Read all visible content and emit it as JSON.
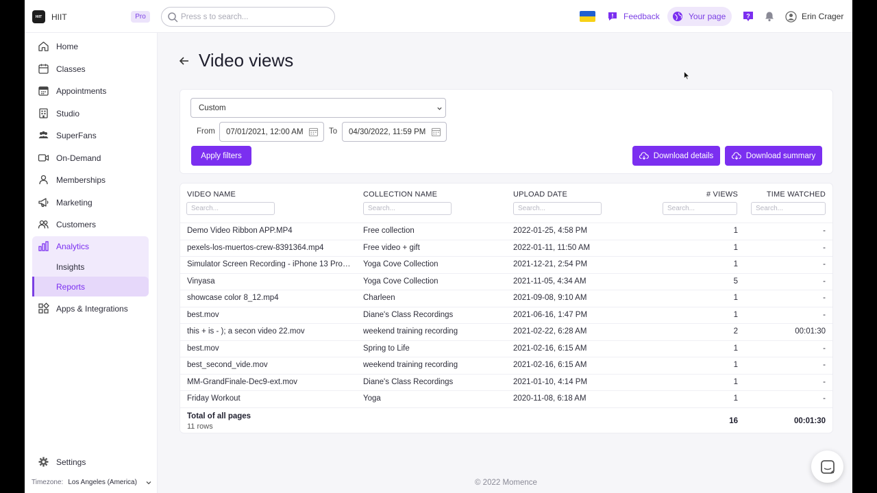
{
  "topbar": {
    "app_name": "HIIT",
    "logo_text": "HIIT",
    "badge": "Pro",
    "search_placeholder": "Press s to search...",
    "feedback": "Feedback",
    "your_page": "Your page",
    "user_name": "Erin Crager"
  },
  "sidebar": {
    "items": [
      {
        "label": "Home",
        "icon": "home-icon"
      },
      {
        "label": "Classes",
        "icon": "calendar-icon"
      },
      {
        "label": "Appointments",
        "icon": "appointments-icon"
      },
      {
        "label": "Studio",
        "icon": "studio-icon"
      },
      {
        "label": "SuperFans",
        "icon": "superfans-icon"
      },
      {
        "label": "On-Demand",
        "icon": "video-icon"
      },
      {
        "label": "Memberships",
        "icon": "memberships-icon"
      },
      {
        "label": "Marketing",
        "icon": "megaphone-icon"
      },
      {
        "label": "Customers",
        "icon": "customers-icon"
      },
      {
        "label": "Analytics",
        "icon": "analytics-icon"
      }
    ],
    "sub_items": [
      "Insights",
      "Reports"
    ],
    "apps": "Apps & Integrations",
    "settings": "Settings",
    "timezone_label": "Timezone:",
    "timezone_value": "Los Angeles (America)"
  },
  "page": {
    "title": "Video views"
  },
  "filters": {
    "range_select": "Custom",
    "from_label": "From",
    "from_value": "07/01/2021, 12:00 AM",
    "to_label": "To",
    "to_value": "04/30/2022, 11:59 PM",
    "apply": "Apply filters",
    "download_details": "Download details",
    "download_summary": "Download summary"
  },
  "table": {
    "headers": [
      "VIDEO NAME",
      "COLLECTION NAME",
      "UPLOAD DATE",
      "# VIEWS",
      "TIME WATCHED"
    ],
    "search_placeholder": "Search...",
    "rows": [
      [
        "Demo Video Ribbon APP.MP4",
        "Free collection",
        "2022-01-25, 4:58 PM",
        "1",
        "-"
      ],
      [
        "pexels-los-muertos-crew-8391364.mp4",
        "Free video + gift",
        "2022-01-11, 11:50 AM",
        "1",
        "-"
      ],
      [
        "Simulator Screen Recording - iPhone 13 Pro -...",
        "Yoga Cove Collection",
        "2021-12-21, 2:54 PM",
        "1",
        "-"
      ],
      [
        "Vinyasa",
        "Yoga Cove Collection",
        "2021-11-05, 4:34 AM",
        "5",
        "-"
      ],
      [
        "showcase color 8_12.mp4",
        "Charleen",
        "2021-09-08, 9:10 AM",
        "1",
        "-"
      ],
      [
        "best.mov",
        "Diane's Class Recordings",
        "2021-06-16, 1:47 PM",
        "1",
        "-"
      ],
      [
        "this + is - ); a secon video 22.mov",
        "weekend training recording",
        "2021-02-22, 6:28 AM",
        "2",
        "00:01:30"
      ],
      [
        "best.mov",
        "Spring to Life",
        "2021-02-16, 6:15 AM",
        "1",
        "-"
      ],
      [
        "best_second_vide.mov",
        "weekend training recording",
        "2021-02-16, 6:15 AM",
        "1",
        "-"
      ],
      [
        "MM-GrandFinale-Dec9-ext.mov",
        "Diane's Class Recordings",
        "2021-01-10, 4:14 PM",
        "1",
        "-"
      ],
      [
        "Friday Workout",
        "Yoga",
        "2020-11-08, 6:18 AM",
        "1",
        "-"
      ]
    ],
    "total_label": "Total of all pages",
    "total_rows": "11 rows",
    "total_views": "16",
    "total_time": "00:01:30"
  },
  "footer": "© 2022 Momence",
  "colors": {
    "accent": "#7b2ff0",
    "accent_light": "#f1eafc",
    "flag_blue": "#1f5fd1",
    "flag_yellow": "#f7d117"
  }
}
